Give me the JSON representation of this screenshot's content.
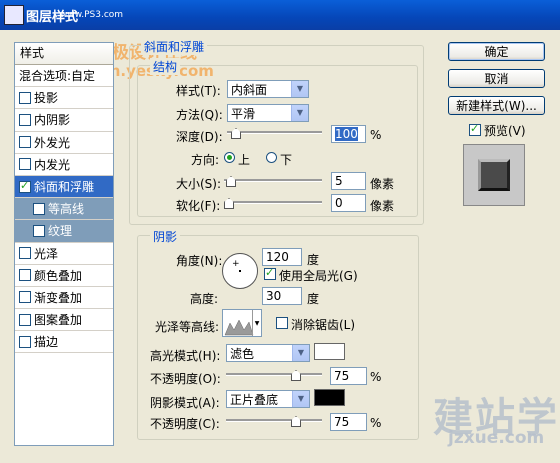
{
  "window": {
    "title": "图层样式",
    "watermark_site": "www.PS3.com"
  },
  "watermarks": {
    "top_cn": "天极设计在线",
    "top_url": "design.yesky.com",
    "bottom_cn": "建站学",
    "bottom_url": "jzxue.com"
  },
  "styles_list": {
    "header": "样式",
    "items": [
      {
        "label": "混合选项:自定",
        "checkbox": false
      },
      {
        "label": "投影",
        "checkbox": true,
        "checked": false
      },
      {
        "label": "内阴影",
        "checkbox": true,
        "checked": false
      },
      {
        "label": "外发光",
        "checkbox": true,
        "checked": false
      },
      {
        "label": "内发光",
        "checkbox": true,
        "checked": false
      },
      {
        "label": "斜面和浮雕",
        "checkbox": true,
        "checked": true,
        "selected": true
      },
      {
        "label": "等高线",
        "checkbox": true,
        "checked": false,
        "sub": true
      },
      {
        "label": "纹理",
        "checkbox": true,
        "checked": false,
        "sub": true
      },
      {
        "label": "光泽",
        "checkbox": true,
        "checked": false
      },
      {
        "label": "颜色叠加",
        "checkbox": true,
        "checked": false
      },
      {
        "label": "渐变叠加",
        "checkbox": true,
        "checked": false
      },
      {
        "label": "图案叠加",
        "checkbox": true,
        "checked": false
      },
      {
        "label": "描边",
        "checkbox": true,
        "checked": false
      }
    ]
  },
  "bevel": {
    "title": "斜面和浮雕",
    "structure_title": "结构",
    "style_label": "样式(T):",
    "style_value": "内斜面",
    "technique_label": "方法(Q):",
    "technique_value": "平滑",
    "depth_label": "深度(D):",
    "depth_value": "100",
    "depth_unit": "%",
    "depth_level": 0.05,
    "direction_label": "方向:",
    "direction_up": "上",
    "direction_down": "下",
    "size_label": "大小(S):",
    "size_value": "5",
    "size_unit": "像素",
    "size_level": 0.02,
    "soften_label": "软化(F):",
    "soften_value": "0",
    "soften_unit": "像素",
    "soften_level": 0.0
  },
  "shading": {
    "title": "阴影",
    "angle_label": "角度(N):",
    "angle_value": "120",
    "angle_unit": "度",
    "global_light_label": "使用全局光(G)",
    "altitude_label": "高度:",
    "altitude_value": "30",
    "altitude_unit": "度",
    "gloss_label": "光泽等高线:",
    "antialias_label": "消除锯齿(L)",
    "highlight_mode_label": "高光模式(H):",
    "highlight_mode_value": "滤色",
    "highlight_color": "#ffffff",
    "highlight_opacity_label": "不透明度(O):",
    "highlight_opacity_value": "75",
    "highlight_opacity_unit": "%",
    "highlight_opacity_level": 0.75,
    "shadow_mode_label": "阴影模式(A):",
    "shadow_mode_value": "正片叠底",
    "shadow_color": "#000000",
    "shadow_opacity_label": "不透明度(C):",
    "shadow_opacity_value": "75",
    "shadow_opacity_unit": "%",
    "shadow_opacity_level": 0.75
  },
  "buttons": {
    "ok": "确定",
    "cancel": "取消",
    "new_style": "新建样式(W)...",
    "preview": "预览(V)"
  }
}
